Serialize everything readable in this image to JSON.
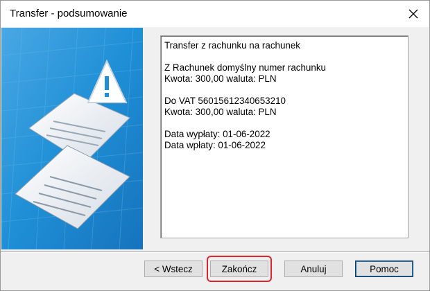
{
  "window": {
    "title": "Transfer - podsumowanie"
  },
  "summary": {
    "lines": [
      "Transfer z rachunku na rachunek",
      "",
      "Z Rachunek domyślny numer rachunku",
      "Kwota: 300,00 waluta: PLN",
      "",
      "Do VAT 56015612340653210",
      "Kwota: 300,00 waluta: PLN",
      "",
      "Data wypłaty: 01-06-2022",
      "Data wpłaty: 01-06-2022"
    ]
  },
  "buttons": {
    "back": "< Wstecz",
    "finish": "Zakończ",
    "cancel": "Anuluj",
    "help": "Pomoc"
  },
  "colors": {
    "accent": "#0078d7",
    "highlight": "#e0242b",
    "art_blue": "#1f8fd6"
  }
}
